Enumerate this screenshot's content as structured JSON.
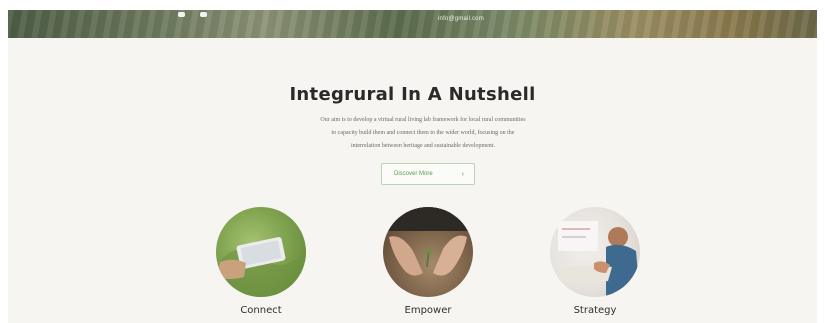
{
  "header": {
    "email": "info@gmail.com"
  },
  "intro": {
    "title": "Integrural In A Nutshell",
    "description_lines": [
      "Our aim is to develop a virtual rural living lab framework for local rural communities",
      "to capacity build them and connect them to the wider world, focusing on the",
      "interrelation between heritage and sustainable development."
    ],
    "cta_label": "Discover More",
    "cta_icon": "chevron-right-icon"
  },
  "features": [
    {
      "label": "Connect",
      "image": "hand-holding-tablet-in-field"
    },
    {
      "label": "Empower",
      "image": "hands-planting-seedling"
    },
    {
      "label": "Strategy",
      "image": "person-writing-at-desk"
    }
  ],
  "colors": {
    "accent": "#5a9a55",
    "page_background": "#f6f5f1",
    "title_text": "#2a2a2a"
  }
}
